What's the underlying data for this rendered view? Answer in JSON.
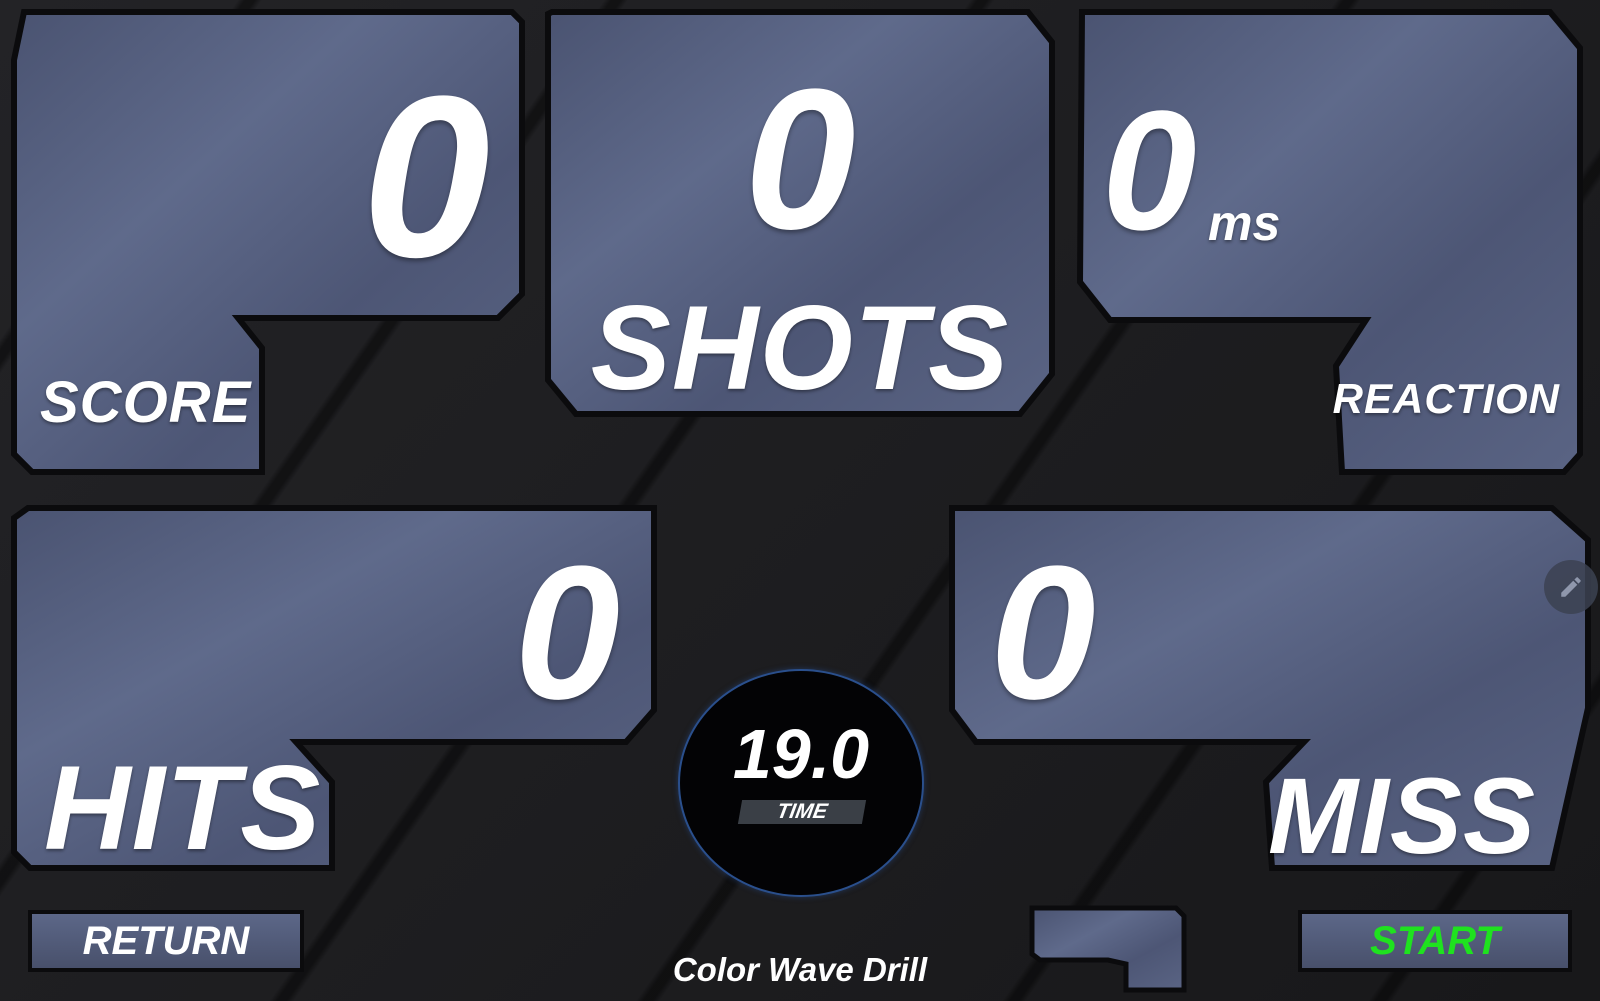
{
  "score": {
    "value": "0",
    "label": "SCORE"
  },
  "shots": {
    "value": "0",
    "label": "SHOTS"
  },
  "reaction": {
    "value": "0",
    "unit": "ms",
    "label": "REACTION"
  },
  "hits": {
    "value": "0",
    "label": "HITS"
  },
  "miss": {
    "value": "0",
    "label": "MISS"
  },
  "timer": {
    "value": "19.0",
    "label": "TIME"
  },
  "buttons": {
    "return_label": "RETURN",
    "start_label": "START"
  },
  "drill_name": "Color Wave Drill",
  "icons": {
    "edit": "pencil-icon"
  },
  "colors": {
    "panel_fill": "#56607f",
    "panel_border": "#0b0b0d",
    "start_text": "#1fe21f",
    "timer_ring": "#2a4f8c"
  }
}
